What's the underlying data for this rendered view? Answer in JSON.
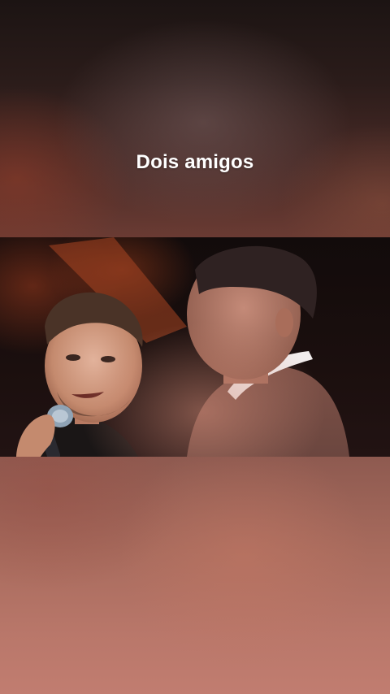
{
  "overlay": {
    "caption": "Dois amigos"
  },
  "video": {
    "icon": "video-frame",
    "accent_colors": [
      "#1b0f0e",
      "#a86b5d",
      "#c48a6e"
    ]
  }
}
